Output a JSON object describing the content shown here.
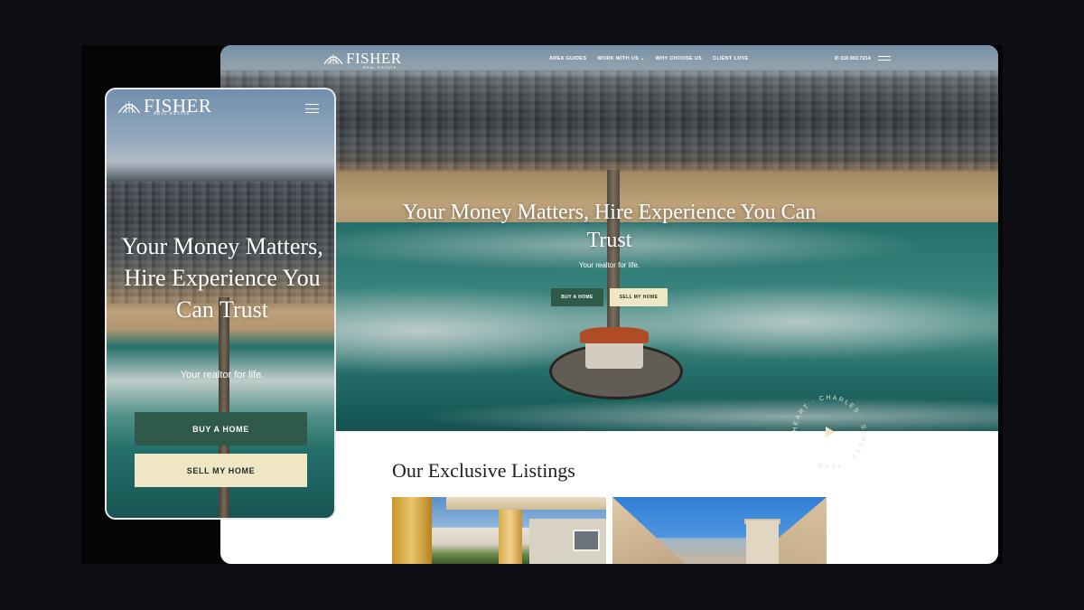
{
  "brand": {
    "name": "FISHER",
    "tagline": "REAL ESTATE"
  },
  "desktop": {
    "nav": {
      "links": [
        "AREA GUIDES",
        "WORK WITH US ⌄",
        "WHY CHOOSE US",
        "CLIENT LOVE"
      ],
      "phone": "✆ 310.902.7214"
    },
    "hero": {
      "title": "Your Money Matters, Hire Experience You Can Trust",
      "subtitle": "Your realtor for life.",
      "buy_label": "BUY A HOME",
      "sell_label": "SELL MY HOME"
    },
    "badge_text": "HEART · CHARLES · STREET · TEAM ·",
    "listings": {
      "title": "Our Exclusive Listings"
    }
  },
  "mobile": {
    "hero": {
      "title": "Your Money Matters, Hire Experience You Can Trust",
      "subtitle": "Your realtor for life.",
      "buy_label": "BUY A HOME",
      "sell_label": "SELL MY HOME"
    }
  },
  "colors": {
    "page_bg": "#0e0f14",
    "primary_green": "#2f5a4a",
    "cream": "#efe6c4",
    "text_dark": "#1e1e1e"
  },
  "icons": [
    "fisher-logo-icon",
    "hamburger-menu-icon",
    "phone-icon",
    "play-icon"
  ]
}
